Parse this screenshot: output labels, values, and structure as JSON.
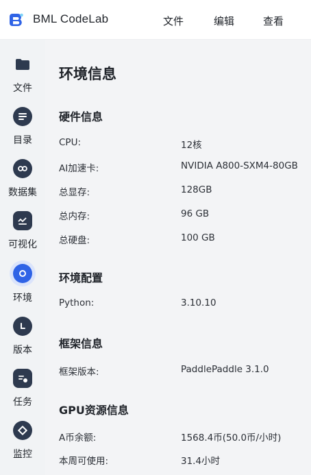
{
  "header": {
    "app_title": "BML CodeLab",
    "menu": {
      "file": "文件",
      "edit": "编辑",
      "view": "查看"
    }
  },
  "sidebar": {
    "items": [
      {
        "label": "文件",
        "icon": "folder-icon"
      },
      {
        "label": "目录",
        "icon": "list-icon"
      },
      {
        "label": "数据集",
        "icon": "dataset-icon"
      },
      {
        "label": "可视化",
        "icon": "chart-icon"
      },
      {
        "label": "环境",
        "icon": "environment-icon",
        "active": true
      },
      {
        "label": "版本",
        "icon": "version-icon"
      },
      {
        "label": "任务",
        "icon": "task-icon"
      },
      {
        "label": "监控",
        "icon": "monitor-icon"
      }
    ]
  },
  "main": {
    "title": "环境信息",
    "sections": {
      "hardware": {
        "title": "硬件信息",
        "rows": [
          {
            "label": "CPU:",
            "value": "12核"
          },
          {
            "label": "AI加速卡:",
            "value": "NVIDIA A800-SXM4-80GB"
          },
          {
            "label": "总显存:",
            "value": "128GB"
          },
          {
            "label": "总内存:",
            "value": "96 GB"
          },
          {
            "label": "总硬盘:",
            "value": "100 GB"
          }
        ]
      },
      "environment": {
        "title": "环境配置",
        "rows": [
          {
            "label": "Python:",
            "value": "3.10.10"
          }
        ]
      },
      "framework": {
        "title": "框架信息",
        "rows": [
          {
            "label": "框架版本:",
            "value": "PaddlePaddle 3.1.0"
          }
        ]
      },
      "gpu": {
        "title": "GPU资源信息",
        "rows": [
          {
            "label": "A币余额:",
            "value": "1568.4币(50.0币/小时)"
          },
          {
            "label": "本周可使用:",
            "value": "31.4小时"
          }
        ]
      }
    }
  },
  "colors": {
    "accent": "#2f63e6",
    "icon_dark": "#2e3a4f",
    "active_ring": "#dbe4fb"
  }
}
